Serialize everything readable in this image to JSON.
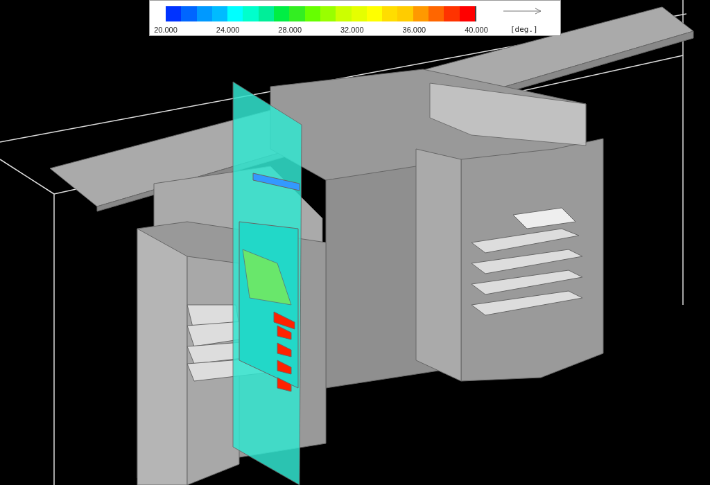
{
  "legend": {
    "swatches": [
      {
        "color": "#0033ff"
      },
      {
        "color": "#0066ff"
      },
      {
        "color": "#0099ff"
      },
      {
        "color": "#00bbff"
      },
      {
        "color": "#00ffff"
      },
      {
        "color": "#00ffcc"
      },
      {
        "color": "#00ee99"
      },
      {
        "color": "#00ee44"
      },
      {
        "color": "#33ee22"
      },
      {
        "color": "#66ff00"
      },
      {
        "color": "#99ff00"
      },
      {
        "color": "#ccff00"
      },
      {
        "color": "#e5ff00"
      },
      {
        "color": "#ffff00"
      },
      {
        "color": "#ffdd00"
      },
      {
        "color": "#ffcc00"
      },
      {
        "color": "#ff9900"
      },
      {
        "color": "#ff6600"
      },
      {
        "color": "#ff3300"
      },
      {
        "color": "#ff0000"
      }
    ],
    "ticks": [
      "20.000",
      "24.000",
      "28.000",
      "32.000",
      "36.000",
      "40.000"
    ],
    "unit": "[deg.]"
  }
}
